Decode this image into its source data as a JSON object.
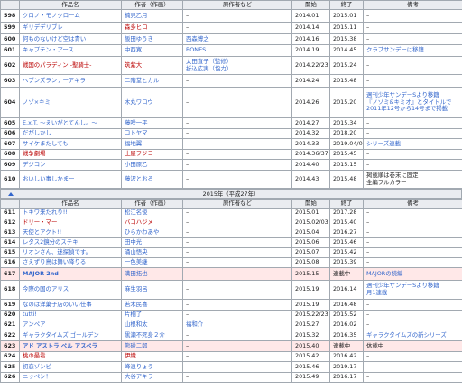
{
  "headers": [
    "",
    "作品名",
    "作者（作画）",
    "原作者など",
    "開始",
    "終了",
    "備考"
  ],
  "top_rows": [
    {
      "no": "598",
      "title": "クロノ・モノクローム",
      "author": "楠見乙月",
      "orig": "–",
      "start": "2014.01",
      "end": "2015.01",
      "note": "–",
      "h": 14
    },
    {
      "no": "599",
      "title": "ギリデデリブレ",
      "author": "森多ヒロ",
      "author_red": true,
      "orig": "–",
      "start": "2014.14",
      "end": "2015.11",
      "note": "–",
      "h": 13
    },
    {
      "no": "600",
      "title": "何ものないけど空は青い",
      "author": "飯田ゆうき",
      "orig": "西森博之",
      "start": "2014.16",
      "end": "2015.38",
      "note": "–",
      "h": 12
    },
    {
      "no": "601",
      "title": "キャプテン・アース",
      "author": "中西寛",
      "orig": "BONES",
      "start": "2014.19",
      "end": "2014.45",
      "note": "クラブサンデーに移籍",
      "h": 13
    },
    {
      "no": "602",
      "title": "戦国のパラディン -聖騎士-",
      "title_red": true,
      "author": "筑紫大",
      "author_red": true,
      "orig": "太田直子（監修）\n折込広実（協力）",
      "start": "2014.22/23",
      "end": "2015.24",
      "note": "–",
      "h": 20
    },
    {
      "no": "603",
      "title": "ヘブンズランナーアキラ",
      "author": "二階堂ヒカル",
      "orig": "–",
      "start": "2014.24",
      "end": "2015.48",
      "note": "–",
      "h": 14
    },
    {
      "no": "604",
      "title": "ノゾ×キミ",
      "author": "木丸ワコウ",
      "orig": "–",
      "start": "2014.26",
      "end": "2015.20",
      "note": "週刊少年サンデーSより移籍\n『ノゾミ&キミオ』とタイトルで\n2011年12号から14号まで掲載",
      "h": 34
    },
    {
      "no": "605",
      "title": "E.x.T. 〜えいがとてんし。〜",
      "author": "藤咲一平",
      "orig": "–",
      "start": "2014.27",
      "end": "2015.34",
      "note": "–",
      "h": 12
    },
    {
      "no": "606",
      "title": "だがしかし",
      "author": "コトヤマ",
      "orig": "–",
      "start": "2014.32",
      "end": "2018.20",
      "note": "–",
      "h": 11
    },
    {
      "no": "607",
      "title": "サイケまたしても",
      "author": "福地翼",
      "orig": "–",
      "start": "2014.33",
      "end": "2019.04/05",
      "note": "シリーズ連載",
      "h": 12
    },
    {
      "no": "608",
      "title": "戦争劇場",
      "title_red": true,
      "author": "土屋フジコ",
      "author_red": true,
      "orig": "–",
      "start": "2014.36/37",
      "end": "2015.45",
      "note": "–",
      "h": 11
    },
    {
      "no": "609",
      "title": "デジコン",
      "author": "小田原乙",
      "orig": "–",
      "start": "2014.40",
      "end": "2015.15",
      "note": "–",
      "h": 12
    },
    {
      "no": "610",
      "title": "おいしい事しかまー",
      "author": "藤沢とおる",
      "orig": "–",
      "start": "2014.43",
      "end": "2015.48",
      "note": "掲載順は巻末に固定\n全編フルカラー",
      "h": 20
    }
  ],
  "year_label": "2015年（平成27年）",
  "bottom_rows": [
    {
      "no": "611",
      "title": "トキワ来たれり!!",
      "author": "松江名俊",
      "orig": "–",
      "start": "2015.01",
      "end": "2017.28",
      "note": "–",
      "h": 11
    },
    {
      "no": "612",
      "title": "ドリー・マー",
      "title_red": true,
      "author": "バコハジメ",
      "author_red": true,
      "orig": "–",
      "start": "2015.02/03",
      "end": "2015.40",
      "note": "–",
      "h": 11
    },
    {
      "no": "613",
      "title": "天使とアクト!!",
      "author": "ひらかわあや",
      "orig": "–",
      "start": "2015.04",
      "end": "2016.27",
      "note": "–",
      "h": 11
    },
    {
      "no": "614",
      "title": "レタス2鏡分のステキ",
      "author": "田中光",
      "orig": "–",
      "start": "2015.06",
      "end": "2015.46",
      "note": "–",
      "h": 11
    },
    {
      "no": "615",
      "title": "リオンさん、迷探偵です。",
      "author": "涌山悟央",
      "orig": "–",
      "start": "2015.07",
      "end": "2015.42",
      "note": "–",
      "h": 11
    },
    {
      "no": "616",
      "title": "さえずり鳥は舞い降りる",
      "author": "一色美継",
      "orig": "–",
      "start": "2015.08",
      "end": "2015.39",
      "note": "–",
      "h": 11
    },
    {
      "no": "617",
      "title": "MAJOR 2nd",
      "author": "満田拓也",
      "orig": "–",
      "start": "2015.15",
      "end": "連載中",
      "note": "MAJORの続編",
      "h": 14,
      "hl": true
    },
    {
      "no": "618",
      "title": "今際の国のアリス",
      "author": "麻生羽呂",
      "orig": "–",
      "start": "2015.19",
      "end": "2016.14",
      "note": "週刊少年サンデーSより移籍\n月1連載",
      "h": 21
    },
    {
      "no": "619",
      "title": "なのは洋菓子店のいい仕事",
      "author": "若木民喜",
      "orig": "–",
      "start": "2015.19",
      "end": "2016.48",
      "note": "–",
      "h": 12
    },
    {
      "no": "620",
      "title": "tutti!",
      "author": "片桐了",
      "orig": "–",
      "start": "2015.22/23",
      "end": "2015.52",
      "note": "–",
      "h": 11
    },
    {
      "no": "621",
      "title": "アンペア",
      "author": "山根和太",
      "orig": "福和介",
      "start": "2015.27",
      "end": "2016.02",
      "note": "–",
      "h": 11
    },
    {
      "no": "622",
      "title": "ギャラクタイムズ ゴールデン",
      "author": "黒瀬不死身２介",
      "orig": "–",
      "start": "2015.32",
      "end": "2016.35",
      "note": "ギャラクタイムズの新シリーズ",
      "h": 12
    },
    {
      "no": "623",
      "title": "アド アストラ ペル アスペラ",
      "author": "熊碰二郎",
      "orig": "–",
      "start": "2015.40",
      "end": "連載中",
      "note": "休載中",
      "h": 12,
      "hl": true
    },
    {
      "no": "624",
      "title": "桃の最看",
      "title_red": true,
      "author": "伊織",
      "author_red": true,
      "orig": "–",
      "start": "2015.42",
      "end": "2016.42",
      "note": "–",
      "h": 11
    },
    {
      "no": "625",
      "title": "初恋ゾンビ",
      "author": "峰浪りょう",
      "orig": "–",
      "start": "2015.46",
      "end": "2019.17",
      "note": "–",
      "h": 12
    },
    {
      "no": "626",
      "title": "ニッペン！",
      "author": "大谷アキラ",
      "orig": "–",
      "start": "2015.49",
      "end": "2016.17",
      "note": "–",
      "h": 11
    }
  ]
}
